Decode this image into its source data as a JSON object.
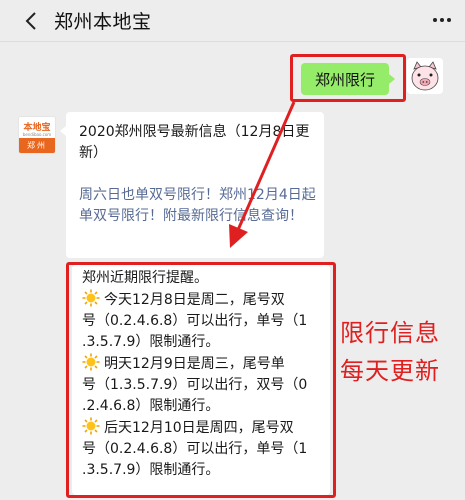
{
  "header": {
    "title": "郑州本地宝",
    "back_icon": "back-arrow-icon",
    "more_icon": "more-dots-icon"
  },
  "user_message": {
    "text": "郑州限行",
    "avatar_icon": "pig-avatar-icon"
  },
  "bot": {
    "avatar_top": "本地宝",
    "avatar_site": "bendibao.com",
    "avatar_city": "郑州"
  },
  "article_card": {
    "title": "2020郑州限号最新信息（12月8日更新）",
    "link": "周六日也单双号限行！郑州12月4日起单双号限行！附最新限行信息查询！"
  },
  "reply": {
    "intro": "郑州近期限行提醒。",
    "days": [
      {
        "line1": "今天12月8日是周二，尾号双",
        "line2": "号（0.2.4.6.8）可以出行，单号（1",
        "line3": ".3.5.7.9）限制通行。"
      },
      {
        "line1": "明天12月9日是周三，尾号单",
        "line2": "号（1.3.5.7.9）可以出行，双号（0",
        "line3": ".2.4.6.8）限制通行。"
      },
      {
        "line1": "后天12月10日是周四，尾号双",
        "line2": "号（0.2.4.6.8）可以出行，单号（1",
        "line3": ".3.5.7.9）限制通行。"
      }
    ],
    "sun_icon": "sun-emoji-icon"
  },
  "annotation": {
    "line1": "限行信息",
    "line2": "每天更新",
    "color": "#e02020"
  },
  "colors": {
    "background": "#ededed",
    "bubble_green": "#95ec69",
    "link_blue": "#576b95",
    "highlight_red": "#e02020",
    "brand_orange": "#e8661e"
  }
}
